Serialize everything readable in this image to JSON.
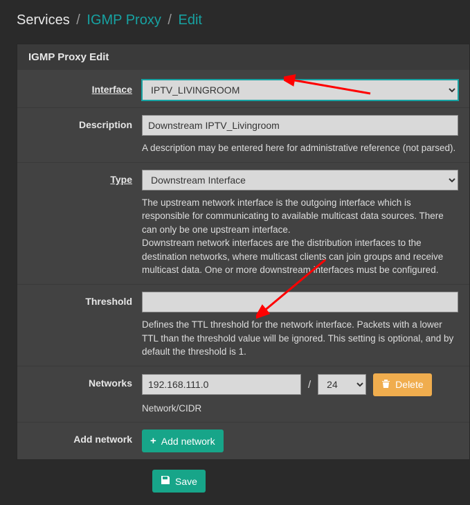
{
  "breadcrumb": {
    "services": "Services",
    "proxy": "IGMP Proxy",
    "edit": "Edit"
  },
  "panel": {
    "title": "IGMP Proxy Edit"
  },
  "labels": {
    "interface": "Interface",
    "description": "Description",
    "type": "Type",
    "threshold": "Threshold",
    "networks": "Networks",
    "add_network": "Add network"
  },
  "fields": {
    "interface": "IPTV_LIVINGROOM",
    "description": "Downstream IPTV_Livingroom",
    "type": "Downstream Interface",
    "threshold": "",
    "network_ip": "192.168.111.0",
    "network_cidr": "24",
    "cidr_sep": "/"
  },
  "help": {
    "description": "A description may be entered here for administrative reference (not parsed).",
    "type": "The upstream network interface is the outgoing interface which is responsible for communicating to available multicast data sources. There can only be one upstream interface.\nDownstream network interfaces are the distribution interfaces to the destination networks, where multicast clients can join groups and receive multicast data. One or more downstream interfaces must be configured.",
    "threshold": "Defines the TTL threshold for the network interface. Packets with a lower TTL than the threshold value will be ignored. This setting is optional, and by default the threshold is 1.",
    "networks": "Network/CIDR"
  },
  "buttons": {
    "delete": "Delete",
    "add_network": "Add network",
    "save": "Save"
  }
}
